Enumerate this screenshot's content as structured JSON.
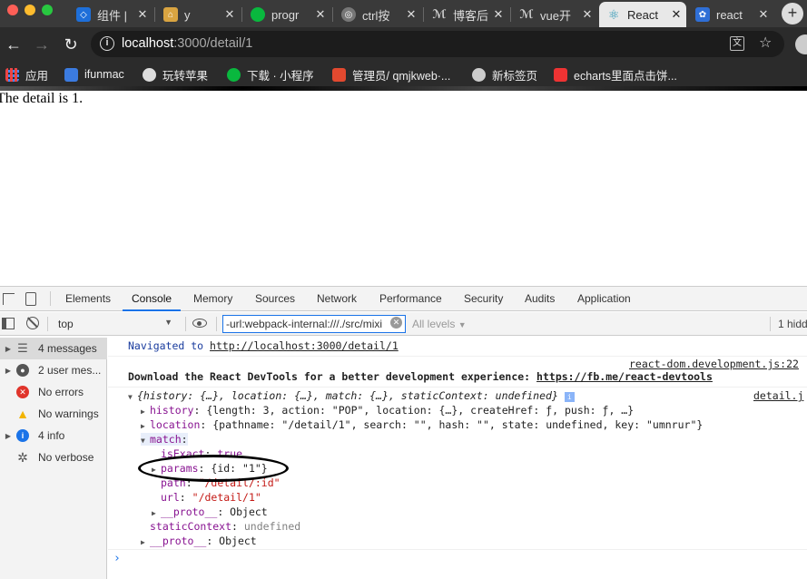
{
  "tabs": [
    {
      "title": "组件 |",
      "favicon_color": "#1e6fd9"
    },
    {
      "title": "y",
      "favicon_color": "#d9a441"
    },
    {
      "title": "progr",
      "favicon_color": "#09b83e"
    },
    {
      "title": "ctrl按",
      "favicon_color": "#777777"
    },
    {
      "title": "博客后",
      "favicon_color": "#888888"
    },
    {
      "title": "vue开",
      "favicon_color": "#888888"
    },
    {
      "title": "React",
      "favicon_color": "#61dafb"
    },
    {
      "title": "react",
      "favicon_color": "#2f6fd6"
    }
  ],
  "toolbar": {
    "url_host": "localhost",
    "url_path": ":3000/detail/1"
  },
  "bookmarks": [
    {
      "label": "应用"
    },
    {
      "label": "ifunmac"
    },
    {
      "label": "玩转苹果"
    },
    {
      "label": "下载 · 小程序"
    },
    {
      "label": "管理员/ qmjkweb·..."
    },
    {
      "label": "新标签页"
    },
    {
      "label": "echarts里面点击饼..."
    }
  ],
  "page": {
    "text": "The detail is 1."
  },
  "devtools": {
    "tabs": [
      "Elements",
      "Console",
      "Memory",
      "Sources",
      "Network",
      "Performance",
      "Security",
      "Audits",
      "Application"
    ],
    "active_tab": "Console",
    "context": "top",
    "filter_value": "-url:webpack-internal:///./src/mixi",
    "levels": "All levels",
    "hidden": "1 hidd",
    "sidebar": [
      {
        "label": "4 messages",
        "icon": "list-icon",
        "color": "#555555"
      },
      {
        "label": "2 user mes...",
        "icon": "user-icon",
        "color": "#555555"
      },
      {
        "label": "No errors",
        "icon": "error-icon",
        "color": "#e0342b"
      },
      {
        "label": "No warnings",
        "icon": "warning-icon",
        "color": "#f2b400"
      },
      {
        "label": "4 info",
        "icon": "info-icon",
        "color": "#1a73e8"
      },
      {
        "label": "No verbose",
        "icon": "gear-icon",
        "color": "#555555"
      }
    ],
    "console": {
      "navigated_label": "Navigated to",
      "navigated_url": "http://localhost:3000/detail/1",
      "source1": "react-dom.development.js:22",
      "devtools_msg": "Download the React DevTools for a better development experience:",
      "devtools_url": "https://fb.me/react-devtools",
      "source2": "detail.j",
      "obj_summary": "{history: {…}, location: {…}, match: {…}, staticContext: undefined}",
      "history_key": "history",
      "history_val": "{length: 3, action: \"POP\", location: {…}, createHref: ƒ, push: ƒ, …}",
      "location_key": "location",
      "location_val": "{pathname: \"/detail/1\", search: \"\", hash: \"\", state: undefined, key: \"umnrur\"}",
      "match_key": "match",
      "isExact_key": "isExact",
      "isExact_val": "true",
      "params_key": "params",
      "params_val": "{id: \"1\"}",
      "path_key": "path",
      "path_val": "\"/detail/:id\"",
      "url_key": "url",
      "url_val": "\"/detail/1\"",
      "proto_key": "__proto__",
      "proto_val": "Object",
      "static_key": "staticContext",
      "static_val": "undefined"
    }
  }
}
